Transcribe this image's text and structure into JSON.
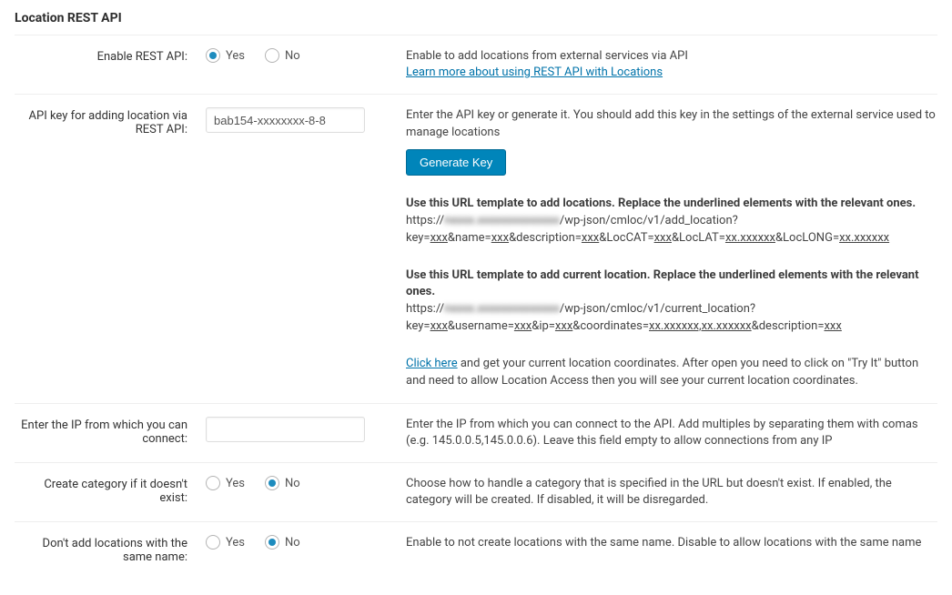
{
  "section_title": "Location REST API",
  "labels": {
    "enable_api": "Enable REST API:",
    "api_key": "API key for adding location via REST API:",
    "ip": "Enter the IP from which you can connect:",
    "create_cat": "Create category if it doesn't exist:",
    "no_dupe": "Don't add locations with the same name:"
  },
  "options": {
    "yes": "Yes",
    "no": "No"
  },
  "enable_api": {
    "desc": "Enable to add locations from external services via API",
    "link": "Learn more about using REST API with Locations"
  },
  "api_key": {
    "value": "bab154‑xxxxxxxx‑8‑8",
    "desc1": "Enter the API key or generate it. You should add this key in the settings of the external service used to manage locations",
    "button": "Generate Key",
    "tmpl1_head": "Use this URL template to add locations. Replace the underlined elements with the relevant ones.",
    "tmpl1_pre": "https://",
    "tmpl1_domain": "nxxxx.xxxxxxxxxxxxxx",
    "tmpl1_path": "/wp-json/cmloc/v1/add_location?",
    "tmpl1_q": {
      "key": "key=",
      "name": "&name=",
      "desc": "&description=",
      "cat": "&LocCAT=",
      "lat": "&LocLAT=",
      "lng": "&LocLONG="
    },
    "xxx": "xxx",
    "xxdec": "xx.xxxxxx",
    "tmpl2_head": "Use this URL template to add current location. Replace the underlined elements with the relevant ones.",
    "tmpl2_path": "/wp-json/cmloc/v1/current_location?",
    "tmpl2_q": {
      "key": "key=",
      "user": "&username=",
      "ip": "&ip=",
      "coord": "&coordinates=",
      "desc": "&description="
    },
    "coordpair": "xx.xxxxxx,xx.xxxxxx",
    "click_here": "Click here",
    "click_text": " and get your current location coordinates. After open you need to click on \"Try It\" button and need to allow Location Access then you will see your current location coordinates."
  },
  "ip": {
    "value": "",
    "desc": "Enter the IP from which you can connect to the API. Add multiples by separating them with comas (e.g. 145.0.0.5,145.0.0.6). Leave this field empty to allow connections from any IP"
  },
  "create_cat": {
    "desc": "Choose how to handle a category that is specified in the URL but doesn't exist. If enabled, the category will be created. If disabled, it will be disregarded."
  },
  "no_dupe": {
    "desc": "Enable to not create locations with the same name. Disable to allow locations with the same name"
  }
}
